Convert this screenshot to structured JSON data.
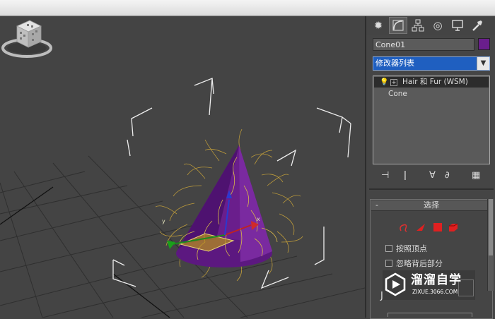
{
  "panel": {
    "tabs": [
      {
        "icon": "create-icon"
      },
      {
        "icon": "modify-icon"
      },
      {
        "icon": "hierarchy-icon"
      },
      {
        "icon": "motion-icon"
      },
      {
        "icon": "display-icon"
      },
      {
        "icon": "utilities-icon"
      }
    ],
    "object_name": "Cone01",
    "object_color": "#6a1e8c",
    "modifier_list_label": "修改器列表",
    "stack": {
      "modifier": "Hair 和 Fur (WSM)",
      "base": "Cone"
    },
    "selection_rollout": {
      "title": "选择",
      "by_vertex_label": "按照顶点",
      "ignore_backfacing_label": "忽略背后部分",
      "extra_char": "J"
    }
  },
  "viewport": {
    "gizmo": {
      "x_label": "x",
      "y_label": "y"
    }
  },
  "watermark": {
    "title": "溜溜自学",
    "subtitle": "ZIXUE.3066.COM"
  },
  "colors": {
    "viewport_bg": "#444444",
    "cone_purple": "#6a1e8c",
    "hair": "#c9a43a",
    "accent_blue": "#1f5fc0"
  }
}
